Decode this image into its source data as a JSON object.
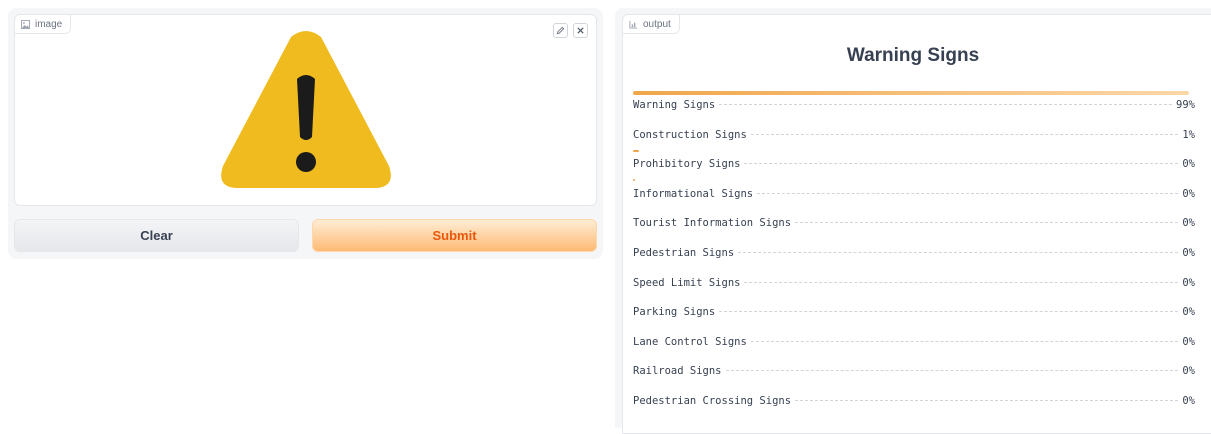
{
  "input": {
    "label": "image",
    "label_icon": "image-icon",
    "edit_icon": "pencil-icon",
    "close_icon": "close-icon",
    "image_icon": "warning-sign-icon"
  },
  "buttons": {
    "clear_label": "Clear",
    "submit_label": "Submit"
  },
  "output": {
    "label": "output",
    "label_icon": "bar-chart-icon",
    "title": "Warning Signs",
    "bar_color": "#f0a64a",
    "results": [
      {
        "label": "Warning Signs",
        "value_text": "99%",
        "value": 0.99
      },
      {
        "label": "Construction Signs",
        "value_text": "1%",
        "value": 0.01
      },
      {
        "label": "Prohibitory Signs",
        "value_text": "0%",
        "value": 0.002
      },
      {
        "label": "Informational Signs",
        "value_text": "0%",
        "value": 0.0
      },
      {
        "label": "Tourist Information Signs",
        "value_text": "0%",
        "value": 0.0
      },
      {
        "label": "Pedestrian Signs",
        "value_text": "0%",
        "value": 0.0
      },
      {
        "label": "Speed Limit Signs",
        "value_text": "0%",
        "value": 0.0
      },
      {
        "label": "Parking Signs",
        "value_text": "0%",
        "value": 0.0
      },
      {
        "label": "Lane Control Signs",
        "value_text": "0%",
        "value": 0.0
      },
      {
        "label": "Railroad Signs",
        "value_text": "0%",
        "value": 0.0
      },
      {
        "label": "Pedestrian Crossing Signs",
        "value_text": "0%",
        "value": 0.0
      }
    ]
  }
}
